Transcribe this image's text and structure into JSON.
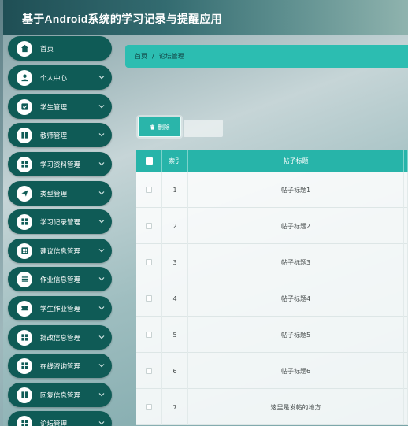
{
  "app": {
    "title": "基于Android系统的学习记录与提醒应用"
  },
  "sidebar": {
    "items": [
      {
        "label": "首页",
        "icon": "home-icon",
        "has_submenu": false
      },
      {
        "label": "个人中心",
        "icon": "user-icon",
        "has_submenu": true
      },
      {
        "label": "学生管理",
        "icon": "checkbox-icon",
        "has_submenu": true
      },
      {
        "label": "教师管理",
        "icon": "grid-icon",
        "has_submenu": true
      },
      {
        "label": "学习资料管理",
        "icon": "grid-icon",
        "has_submenu": true
      },
      {
        "label": "类型管理",
        "icon": "send-icon",
        "has_submenu": true
      },
      {
        "label": "学习记录管理",
        "icon": "grid-icon",
        "has_submenu": true
      },
      {
        "label": "建议信息管理",
        "icon": "dots-grid-icon",
        "has_submenu": true
      },
      {
        "label": "作业信息管理",
        "icon": "list-icon",
        "has_submenu": true
      },
      {
        "label": "学生作业管理",
        "icon": "ticket-icon",
        "has_submenu": true
      },
      {
        "label": "批改信息管理",
        "icon": "grid-icon",
        "has_submenu": true
      },
      {
        "label": "在线咨询管理",
        "icon": "grid-icon",
        "has_submenu": true
      },
      {
        "label": "回复信息管理",
        "icon": "grid-icon",
        "has_submenu": true
      },
      {
        "label": "论坛管理",
        "icon": "grid-icon",
        "has_submenu": true
      }
    ]
  },
  "breadcrumb": {
    "home": "首页",
    "separator": "/",
    "current": "论坛管理"
  },
  "toolbar": {
    "delete_label": "删除"
  },
  "table": {
    "headers": {
      "index": "索引",
      "title": "帖子标题"
    },
    "rows": [
      {
        "index": "1",
        "title": "帖子标题1"
      },
      {
        "index": "2",
        "title": "帖子标题2"
      },
      {
        "index": "3",
        "title": "帖子标题3"
      },
      {
        "index": "4",
        "title": "帖子标题4"
      },
      {
        "index": "5",
        "title": "帖子标题5"
      },
      {
        "index": "6",
        "title": "帖子标题6"
      },
      {
        "index": "7",
        "title": "这里是发帖的地方"
      }
    ]
  },
  "colors": {
    "sidebar_bg": "#0f5b56",
    "accent": "#2cbdb1",
    "header": "#27b4a9"
  }
}
